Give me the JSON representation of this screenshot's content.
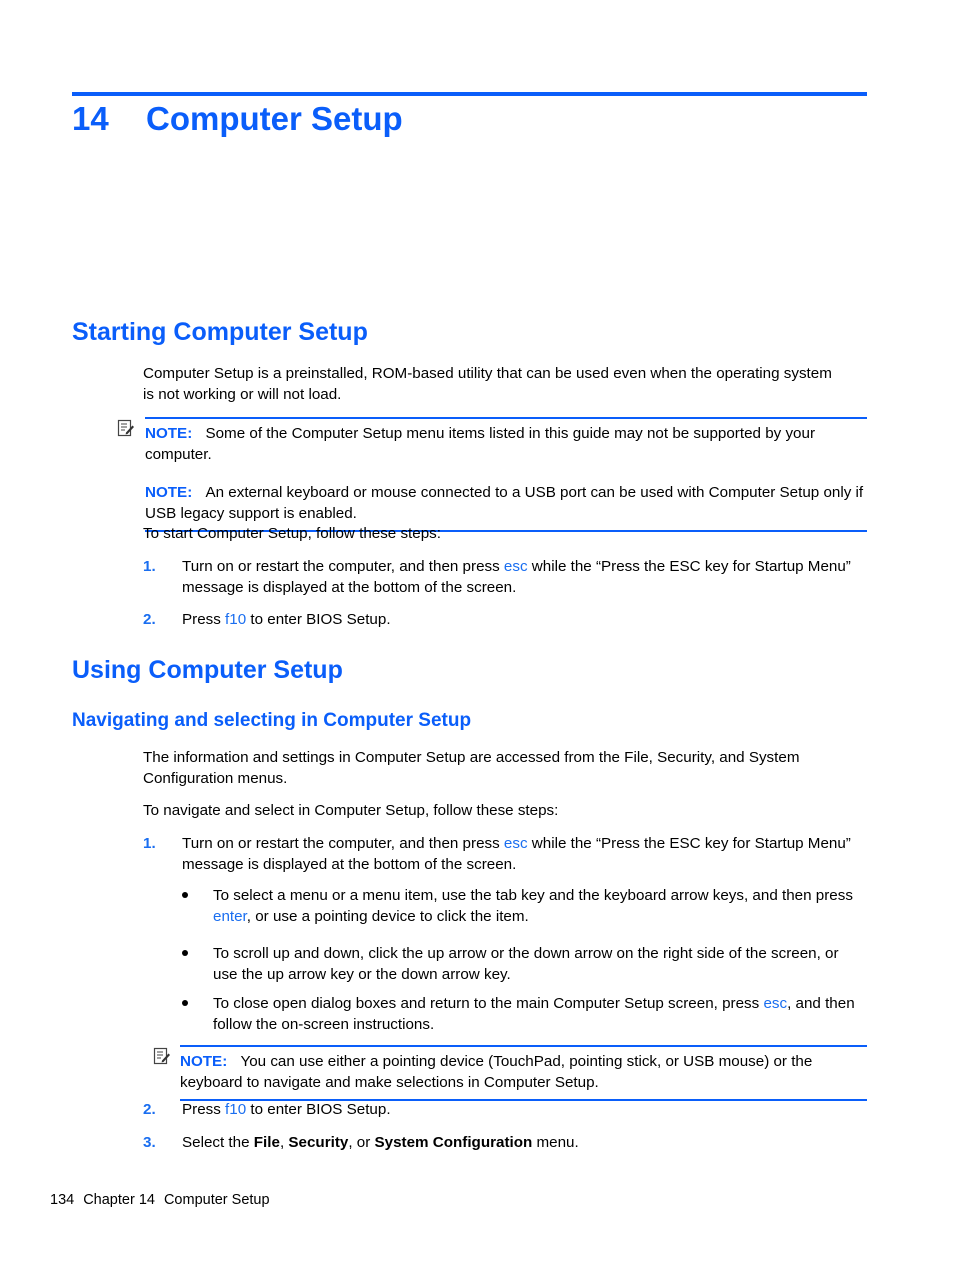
{
  "colors": {
    "heading_blue": "#0a5efa",
    "inline_blue": "#1a6ef0",
    "body_black": "#000000",
    "page_background": "#ffffff"
  },
  "chapter": {
    "number": "14",
    "title": "Computer Setup"
  },
  "sections": {
    "starting": {
      "heading": "Starting Computer Setup",
      "intro": "Computer Setup is a preinstalled, ROM-based utility that can be used even when the operating system is not working or will not load.",
      "note_box": {
        "icon": "note-pencil-icon",
        "notes": [
          {
            "label": "NOTE:",
            "text": "Some of the Computer Setup menu items listed in this guide may not be supported by your computer."
          },
          {
            "label": "NOTE:",
            "text": "An external keyboard or mouse connected to a USB port can be used with Computer Setup only if USB legacy support is enabled."
          }
        ]
      },
      "steps_lead_in": "To start Computer Setup, follow these steps:",
      "steps": [
        {
          "number": "1.",
          "part1": "Turn on or restart the computer, and then press ",
          "key": "esc",
          "part2": " while the “Press the ESC key for Startup Menu” message is displayed at the bottom of the screen."
        },
        {
          "number": "2.",
          "part1": "Press ",
          "key": "f10",
          "part2": " to enter BIOS Setup."
        }
      ]
    },
    "using": {
      "heading": "Using Computer Setup",
      "subheading": "Navigating and selecting in Computer Setup",
      "intro": "The information and settings in Computer Setup are accessed from the File, Security, and System Configuration menus.",
      "steps_lead_in": "To navigate and select in Computer Setup, follow these steps:",
      "step1": {
        "number": "1.",
        "part1": "Turn on or restart the computer, and then press ",
        "key": "esc",
        "part2": " while the “Press the ESC key for Startup Menu” message is displayed at the bottom of the screen."
      },
      "bullets": [
        {
          "part1": "To select a menu or a menu item, use the tab key and the keyboard arrow keys, and then press ",
          "key": "enter",
          "part2": ", or use a pointing device to click the item."
        },
        {
          "part1": "To scroll up and down, click the up arrow or the down arrow on the right side of the screen, or use the up arrow key or the down arrow key.",
          "key": "",
          "part2": ""
        },
        {
          "part1": "To close open dialog boxes and return to the main Computer Setup screen, press ",
          "key": "esc",
          "part2": ", and then follow the on-screen instructions."
        }
      ],
      "note_box": {
        "icon": "note-pencil-icon",
        "label": "NOTE:",
        "text": "You can use either a pointing device (TouchPad, pointing stick, or USB mouse) or the keyboard to navigate and make selections in Computer Setup."
      },
      "step2": {
        "number": "2.",
        "part1": "Press ",
        "key": "f10",
        "part2": " to enter BIOS Setup."
      },
      "step3": {
        "number": "3.",
        "part1": "Select the ",
        "bold1": "File",
        "sep1": ", ",
        "bold2": "Security",
        "sep2": ", or ",
        "bold3": "System Configuration",
        "part2": " menu."
      }
    }
  },
  "footer": {
    "page_number": "134",
    "chapter_label": "Chapter 14",
    "chapter_title": "Computer Setup"
  }
}
